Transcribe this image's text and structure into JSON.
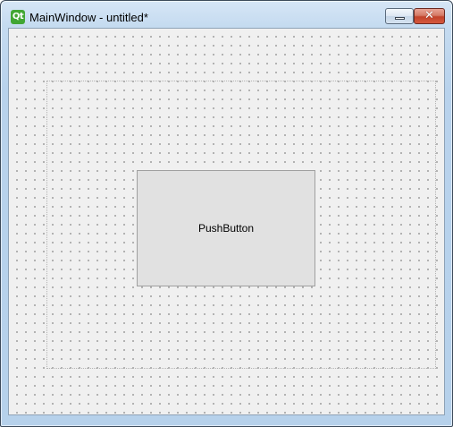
{
  "window": {
    "app_icon": "qt-logo-icon",
    "icon_text": "Qt",
    "title": "MainWindow - untitled*",
    "controls": {
      "minimize": "minimize-icon",
      "close": "close-icon",
      "close_glyph": "✕"
    }
  },
  "form": {
    "grid": "dotted",
    "push_button": {
      "label": "PushButton"
    }
  },
  "colors": {
    "canvas_bg": "#f0f0f0",
    "grid_dot": "#7a7a7a",
    "button_bg": "#e1e1e1",
    "button_border": "#a0a0a0",
    "qt_green": "#41a633",
    "close_red": "#c2432b"
  }
}
